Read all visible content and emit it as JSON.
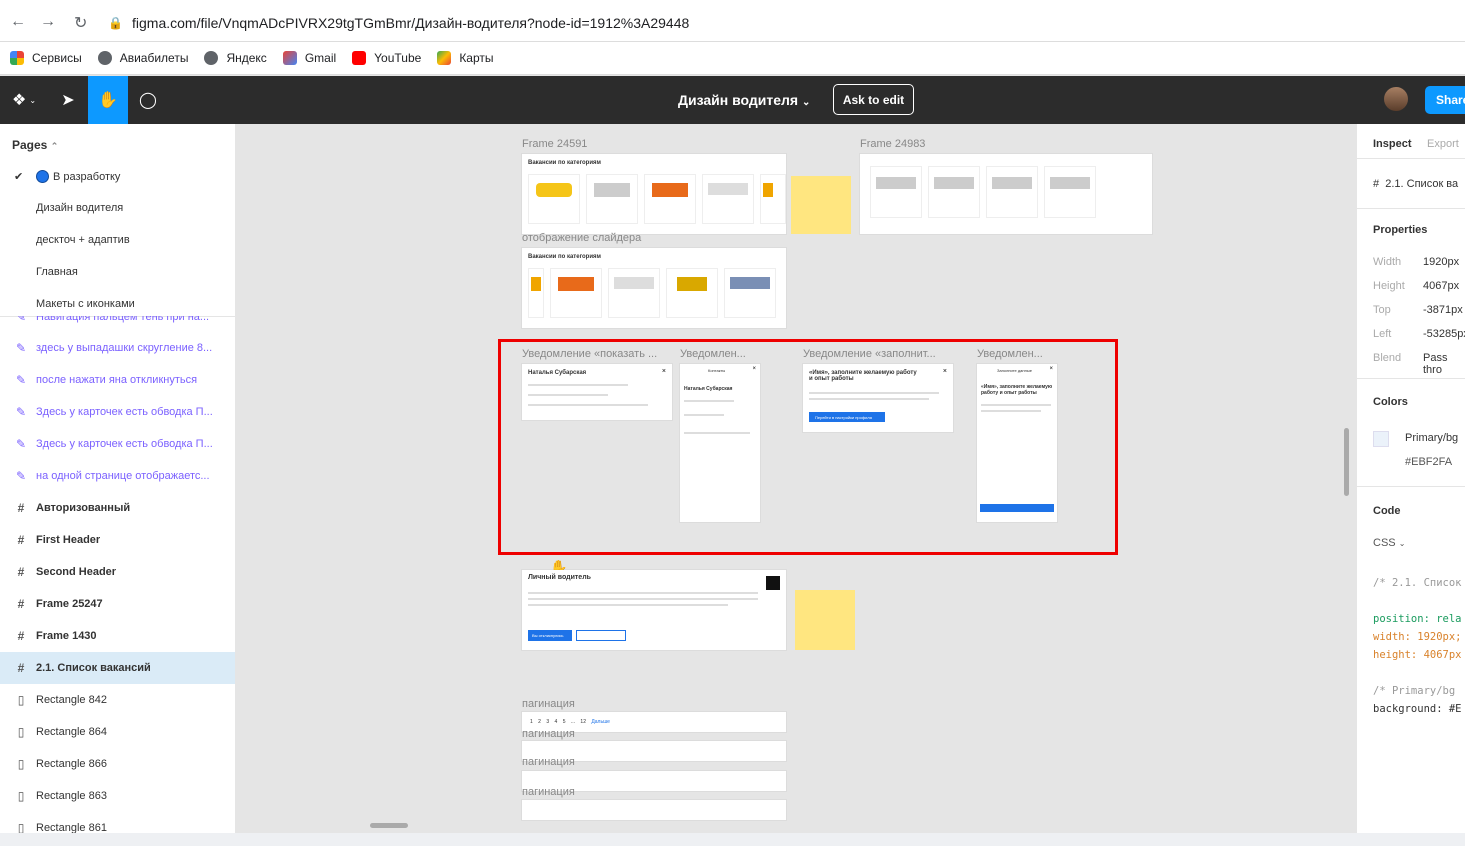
{
  "browser": {
    "url": "figma.com/file/VnqmADcPIVRX29tgTGmBmr/Дизайн-водителя?node-id=1912%3A29448",
    "bookmarks": [
      {
        "label": "Сервисы",
        "icon": "apps-grid-icon",
        "color": "#ea4335"
      },
      {
        "label": "Авиабилеты",
        "icon": "globe-icon",
        "color": "#5f6368"
      },
      {
        "label": "Яндекс",
        "icon": "globe-icon",
        "color": "#5f6368"
      },
      {
        "label": "Gmail",
        "icon": "gmail-icon",
        "color": "#ea4335"
      },
      {
        "label": "YouTube",
        "icon": "youtube-icon",
        "color": "#ff0000"
      },
      {
        "label": "Карты",
        "icon": "maps-icon",
        "color": "#34a853"
      }
    ]
  },
  "topbar": {
    "title": "Дизайн водителя",
    "ask_edit": "Ask to edit",
    "share": "Share",
    "accent": "#0d99ff"
  },
  "left": {
    "pages_title": "Pages",
    "pages": [
      "В разработку",
      "Дизайн водителя",
      "дескточ + адаптив",
      "Главная",
      "Макеты с иконками"
    ],
    "layers": [
      {
        "label": "Навигация пальцем тень при на...",
        "type": "comment"
      },
      {
        "label": "здесь у выпадашки скругление 8...",
        "type": "comment"
      },
      {
        "label": "после нажати яна откликнуться",
        "type": "comment"
      },
      {
        "label": "Здесь у карточек есть обводка П...",
        "type": "comment"
      },
      {
        "label": "Здесь у карточек есть обводка П...",
        "type": "comment"
      },
      {
        "label": "на одной странице отображаетс...",
        "type": "comment"
      },
      {
        "label": "Авторизованный",
        "type": "frame"
      },
      {
        "label": "First Header",
        "type": "frame"
      },
      {
        "label": "Second Header",
        "type": "frame"
      },
      {
        "label": "Frame 25247",
        "type": "frame"
      },
      {
        "label": "Frame 1430",
        "type": "frame"
      },
      {
        "label": "2.1. Список вакансий",
        "type": "frame-selected"
      },
      {
        "label": "Rectangle 842",
        "type": "rect"
      },
      {
        "label": "Rectangle 864",
        "type": "rect"
      },
      {
        "label": "Rectangle 866",
        "type": "rect"
      },
      {
        "label": "Rectangle 863",
        "type": "rect"
      },
      {
        "label": "Rectangle 861",
        "type": "rect"
      }
    ]
  },
  "canvas": {
    "labels": {
      "f1": "Frame 24591",
      "f2": "Frame 24983",
      "slider": "отображение слайдера",
      "n1": "Уведомление «показать ...",
      "n2": "Уведомлен...",
      "n3": "Уведомление «заполнит...",
      "n4": "Уведомлен...",
      "pag1": "пагинация",
      "pag2": "пагинация",
      "pag3": "пагинация",
      "pag4": "пагинация"
    },
    "card_title": "Вакансии по категориям",
    "contact_name": "Наталья Субарская",
    "contacts_title": "Контакты",
    "fill_title": "«Имя», заполните желаемую работу и опыт работы",
    "fill_btn": "Перейти в настройки профиля",
    "fill_data": "Заполните данные",
    "job_title": "Личный водитель",
    "job_btn": "Вы откликнулись",
    "pages_nums": [
      "1",
      "2",
      "3",
      "4",
      "5",
      "...",
      "12",
      "Дальше"
    ]
  },
  "right": {
    "tab_inspect": "Inspect",
    "tab_export": "Export",
    "node": "2.1. Список ва",
    "properties": "Properties",
    "props": [
      {
        "k": "Width",
        "v": "1920px"
      },
      {
        "k": "Height",
        "v": "4067px"
      },
      {
        "k": "Top",
        "v": "-3871px"
      },
      {
        "k": "Left",
        "v": "-53285px"
      },
      {
        "k": "Blend",
        "v": "Pass thro"
      }
    ],
    "colors_title": "Colors",
    "color_name": "Primary/bg",
    "color_hex": "#EBF2FA",
    "code_title": "Code",
    "code_lang": "CSS",
    "code_comment1": "/* 2.1. Список",
    "code_pos": "position: rela",
    "code_w": "width: 1920px;",
    "code_h": "height: 4067px",
    "code_comment2": "/* Primary/bg",
    "code_bg": "background: #E"
  }
}
